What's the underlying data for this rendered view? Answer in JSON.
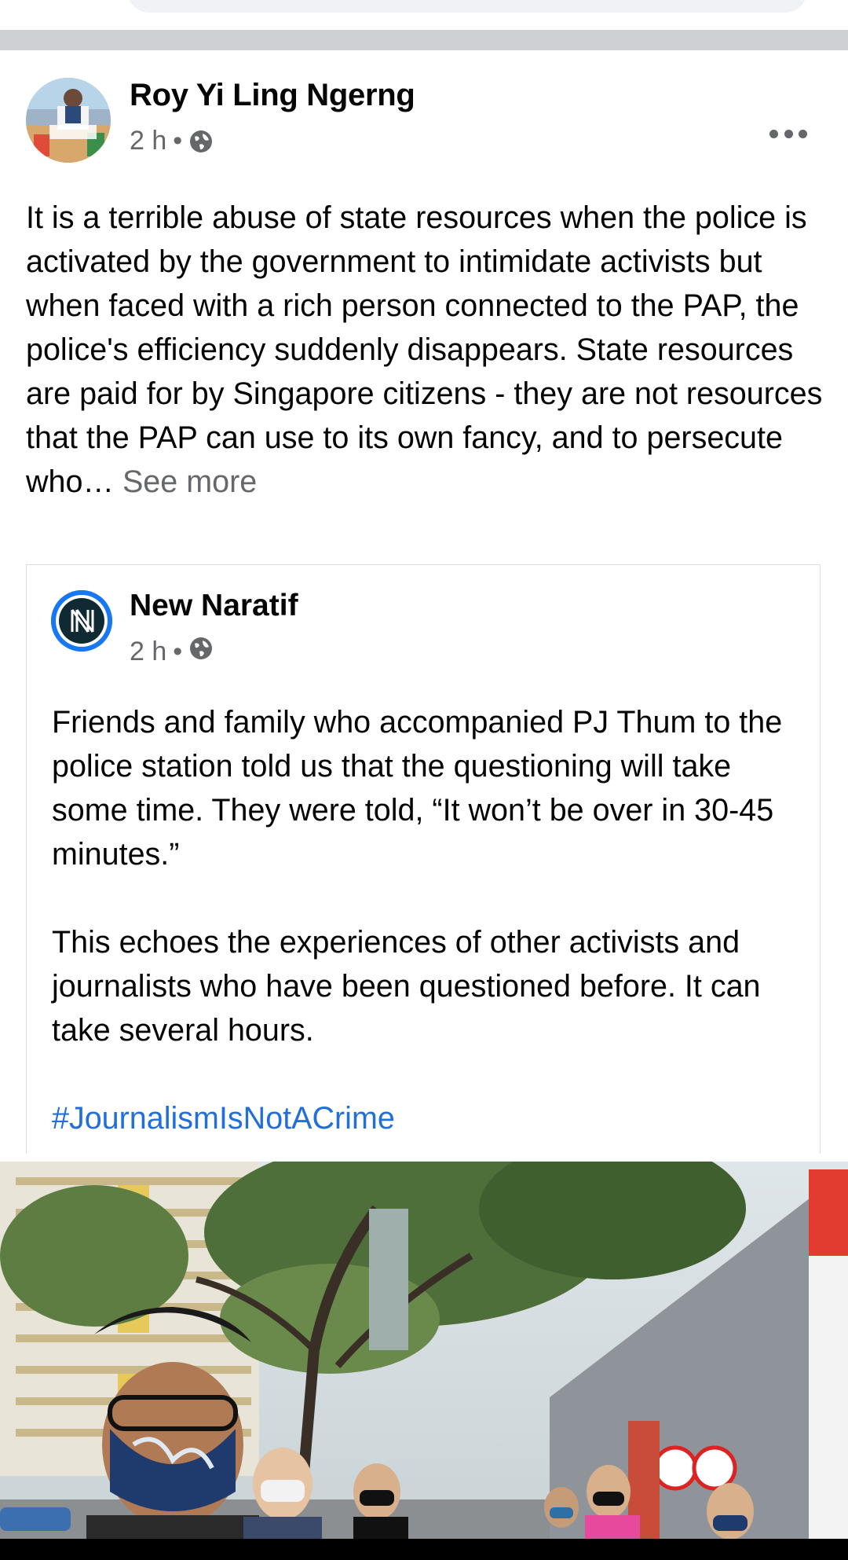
{
  "post": {
    "author": "Roy Yi Ling Ngerng",
    "time": "2 h",
    "separator": "•",
    "privacy_icon": "globe-icon",
    "more_icon": "more-horizontal-icon",
    "text": "It is a terrible abuse of state resources when the police is activated by the government to intimidate activists but when faced with a rich person connected to the PAP, the police's efficiency suddenly disappears. State resources are paid for by Singapore citizens - they are not resources that the PAP can use to its own fancy, and to persecute who…",
    "see_more": "See more"
  },
  "shared_post": {
    "author": "New Naratif",
    "time": "2 h",
    "separator": "•",
    "privacy_icon": "globe-icon",
    "paragraph_1": "Friends and family who accompanied PJ Thum to the police station told us that the questioning will take some time. They were told, “It won’t be over in 30-45 minutes.”",
    "paragraph_2": "This echoes the experiences of other activists and journalists who have been questioned before. It can take several hours.",
    "hashtag": "#JournalismIsNotACrime"
  },
  "colors": {
    "separator": "#ced0d4",
    "secondary_text": "#65676b",
    "link": "#216fdb",
    "brand_blue": "#1877f2"
  }
}
